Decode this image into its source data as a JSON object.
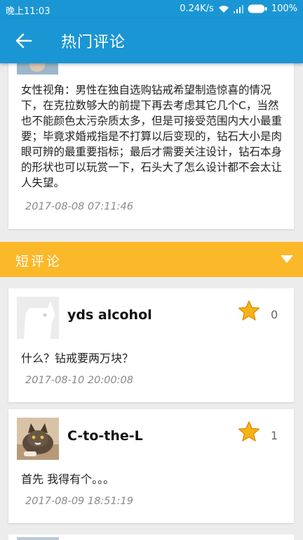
{
  "status_bar": {
    "time": "晚上11:03",
    "speed": "0.24K/s",
    "battery": "100%"
  },
  "header": {
    "title": "热门评论",
    "back_icon": "arrow-left-icon",
    "color": "#1a96d4"
  },
  "featured_comment": {
    "text": "女性视角：男性在独自选购钻戒希望制造惊喜的情况下，在克拉数够大的前提下再去考虑其它几个C，当然也不能颜色太污杂质太多，但是可接受范围内大小最重要；毕竟求婚戒指是不打算以后变现的，钻石大小是肉眼可辨的最重要指标；最后才需要关注设计，钻石本身的形状也可以玩赏一下，石头大了怎么设计都不会太让人失望。",
    "date": "2017-08-08 07:11:46"
  },
  "section": {
    "label": "短评论",
    "color": "#fbb829",
    "toggle_icon": "caret-down-icon"
  },
  "comments": [
    {
      "name": "yds alcohol",
      "likes": "0",
      "text": "什么？钻戒要两万块？",
      "date": "2017-08-10 20:00:08",
      "avatar_icon": "default-avatar-icon"
    },
    {
      "name": "C-to-the-L",
      "likes": "1",
      "text": "首先 我得有个。。。",
      "date": "2017-08-09 18:51:19",
      "avatar_icon": "cat-photo-avatar"
    }
  ]
}
